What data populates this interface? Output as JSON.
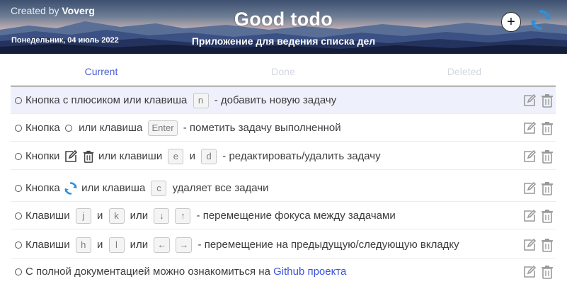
{
  "header": {
    "created_prefix": "Created by",
    "created_author": "Voverg",
    "title": "Good todo",
    "subtitle": "Приложение для ведения списка дел",
    "date": "Понедельник, 04 июль 2022",
    "add_label": "+"
  },
  "tabs": {
    "current": "Current",
    "done": "Done",
    "deleted": "Deleted"
  },
  "tasks": [
    {
      "a": "Кнопка с плюсиком или клавиша",
      "k1": "n",
      "b": "- добавить новую задачу"
    },
    {
      "a": "Кнопка",
      "b": "или клавиша",
      "k1": "Enter",
      "c": "- пометить задачу выполненной"
    },
    {
      "a": "Кнопки",
      "b": "или клавиши",
      "k1": "e",
      "and": "и",
      "k2": "d",
      "c": "- редактировать/удалить задачу"
    },
    {
      "a": "Кнопка",
      "b": "или клавиша",
      "k1": "c",
      "c": "удаляет все задачи"
    },
    {
      "a": "Клавиши",
      "k1": "j",
      "and": "и",
      "k2": "k",
      "or": "или",
      "k3": "↓",
      "k4": "↑",
      "c": "- перемещение фокуса между задачами"
    },
    {
      "a": "Клавиши",
      "k1": "h",
      "and": "и",
      "k2": "l",
      "or": "или",
      "k3": "←",
      "k4": "→",
      "c": "- перемещение на предыдущую/следующую вкладку"
    },
    {
      "a": "С полной документацией можно ознакомиться на",
      "link": "Github проекта"
    }
  ],
  "colors": {
    "accent": "#4a5bd6",
    "link": "#3b54d9",
    "refresh": "#2f8fd8",
    "focused_row": "#eef1fb"
  },
  "icons": [
    "plus-icon",
    "refresh-icon",
    "edit-icon",
    "trash-icon",
    "circle-bullet-icon"
  ]
}
